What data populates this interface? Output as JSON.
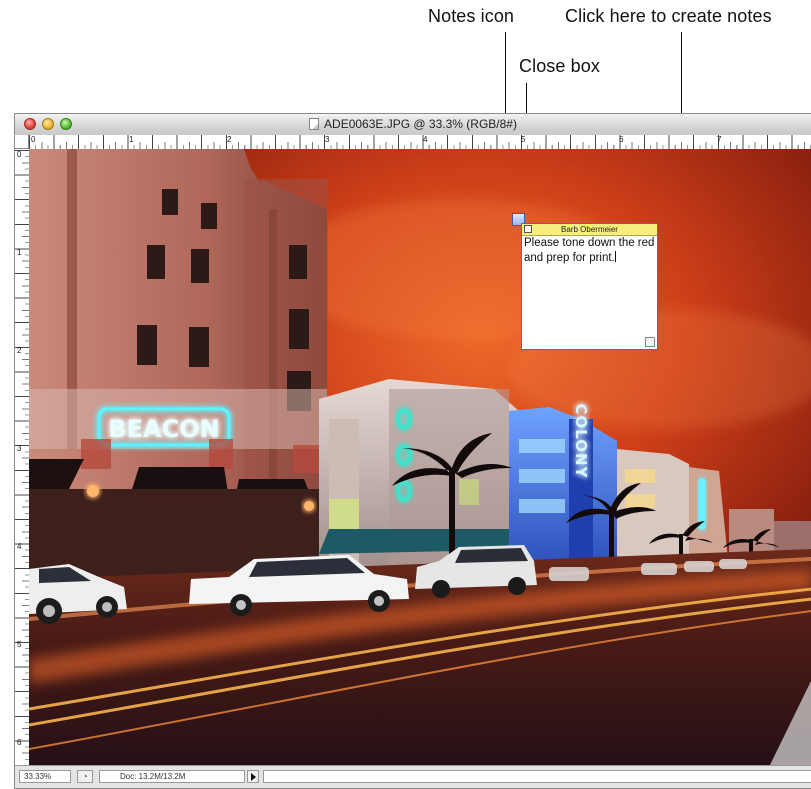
{
  "callouts": {
    "notes_icon": "Notes icon",
    "create_notes": "Click here to create notes",
    "close_box": "Close box"
  },
  "window": {
    "title": "ADE0063E.JPG @ 33.3% (RGB/8#)"
  },
  "ruler": {
    "top_ticks": [
      "0",
      "1",
      "2",
      "3",
      "4",
      "5",
      "6",
      "7"
    ],
    "left_ticks": [
      "0",
      "1",
      "2",
      "3",
      "4",
      "5",
      "6"
    ]
  },
  "note": {
    "author": "Barb Obermeier",
    "text": "Please tone down the red and prep for print."
  },
  "image": {
    "sign_text": "BEACON",
    "vertical_sign": "COLONY"
  },
  "statusbar": {
    "zoom": "33.33%",
    "doc_info": "Doc: 13.2M/13.2M"
  },
  "colors": {
    "sky": "#d2401a",
    "note_header": "#f5ee7a",
    "neon": "#47e4ff"
  }
}
